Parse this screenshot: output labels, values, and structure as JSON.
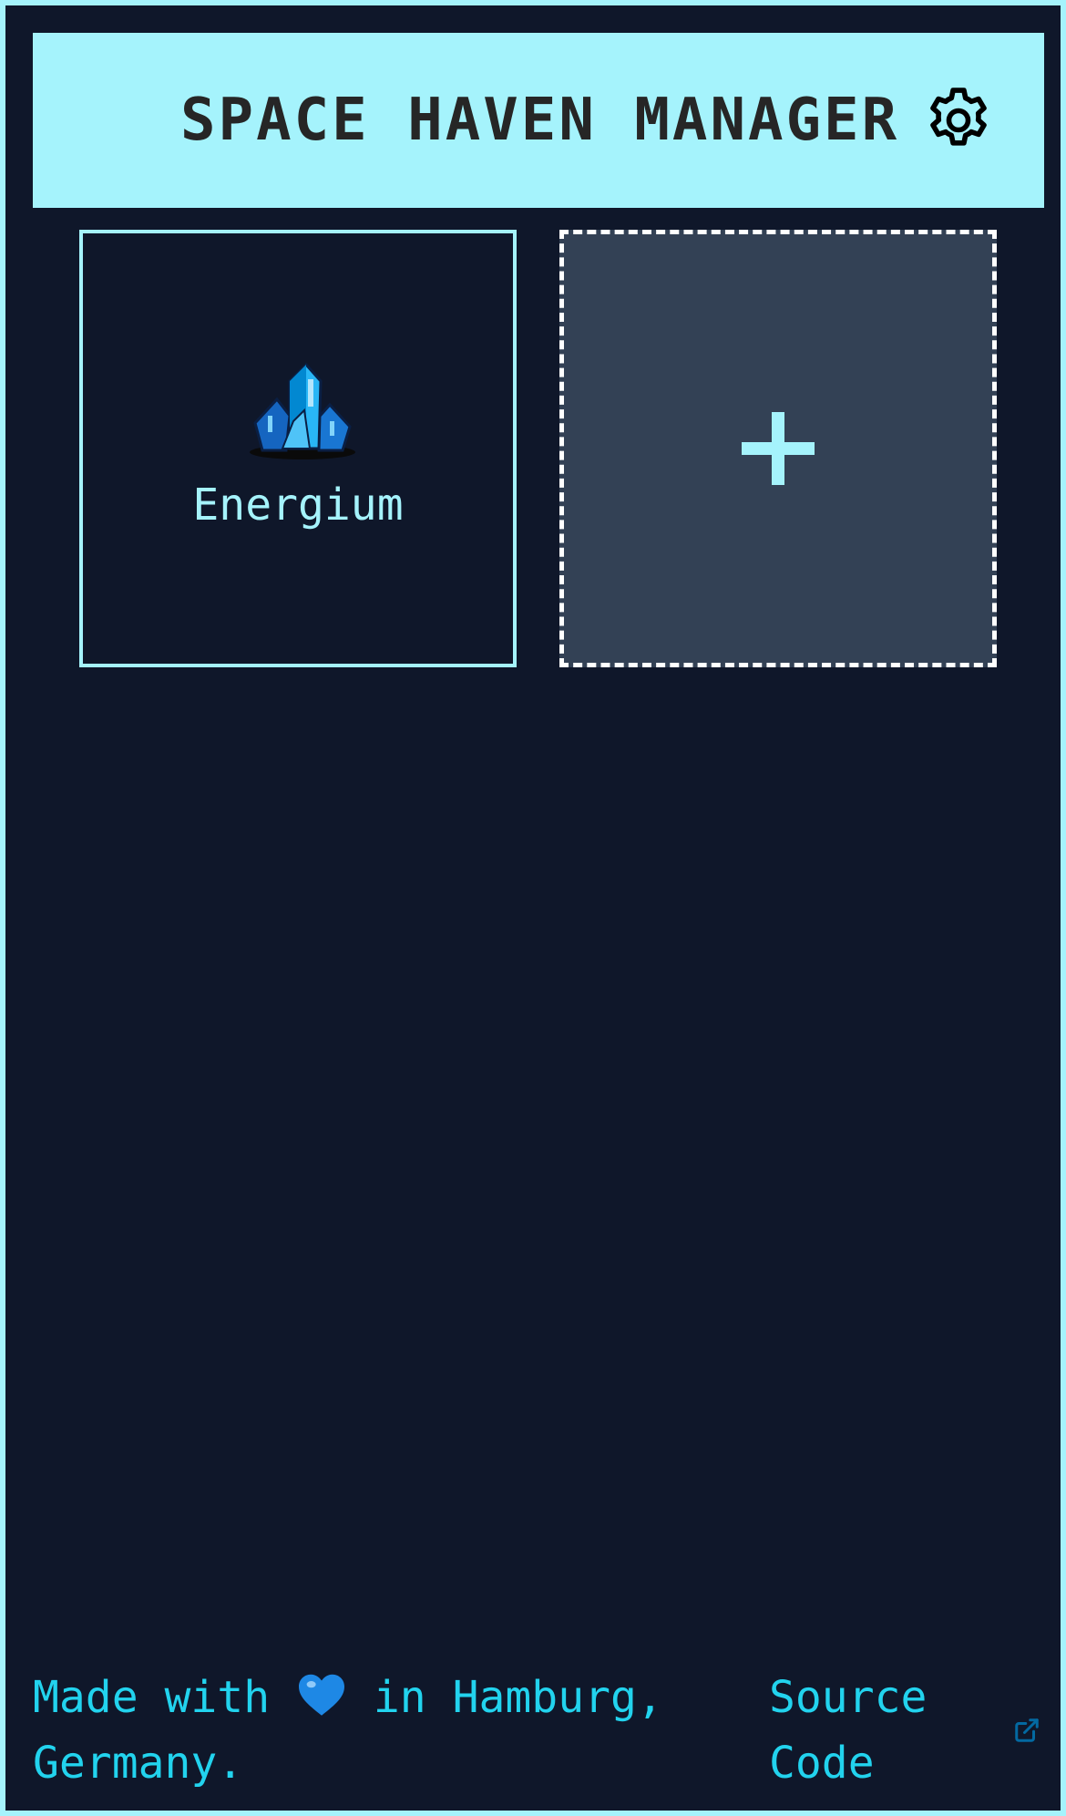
{
  "header": {
    "title": "SPACE HAVEN MANAGER",
    "settings_icon": "gear-icon"
  },
  "resources": [
    {
      "name": "Energium",
      "icon": "crystal-icon"
    }
  ],
  "add_card": {
    "icon": "plus-icon"
  },
  "footer": {
    "made_with_prefix": "Made with",
    "heart_icon": "blue-heart-icon",
    "made_with_suffix": "in Hamburg, Germany.",
    "source_label": "Source Code",
    "link_icon": "external-link-icon"
  },
  "colors": {
    "background": "#0f172a",
    "accent": "#a5f3fc",
    "footer_text": "#22d3ee",
    "add_card_bg": "#334155",
    "title_text": "#262626"
  }
}
